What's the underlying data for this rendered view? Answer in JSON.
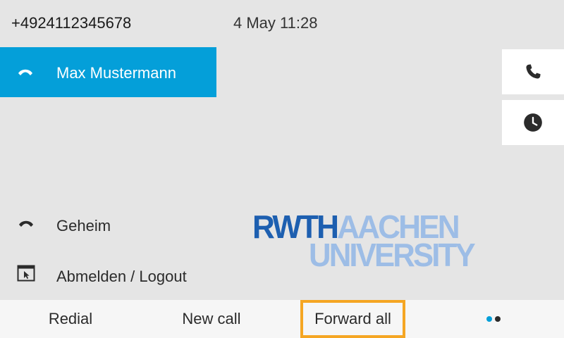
{
  "header": {
    "phone_number": "+4924112345678",
    "datetime": "4 May 11:28"
  },
  "lines": {
    "active": {
      "label": "Max Mustermann",
      "icon": "handset-icon"
    }
  },
  "side_buttons": [
    {
      "name": "call",
      "icon": "phone-icon"
    },
    {
      "name": "recents",
      "icon": "clock-icon"
    }
  ],
  "menu_items": [
    {
      "label": "Geheim",
      "icon": "handset-icon"
    },
    {
      "label": "Abmelden / Logout",
      "icon": "logout-window-icon"
    }
  ],
  "logo": {
    "line1_a": "RWTH",
    "line1_b": "AACHEN",
    "line2": "UNIVERSITY"
  },
  "softkeys": {
    "redial": "Redial",
    "new_call": "New call",
    "forward_all": "Forward all"
  },
  "colors": {
    "accent": "#049fd9",
    "highlight": "#f5a623",
    "logo_dark": "#1d5fb0",
    "logo_light": "#9dbde6"
  }
}
